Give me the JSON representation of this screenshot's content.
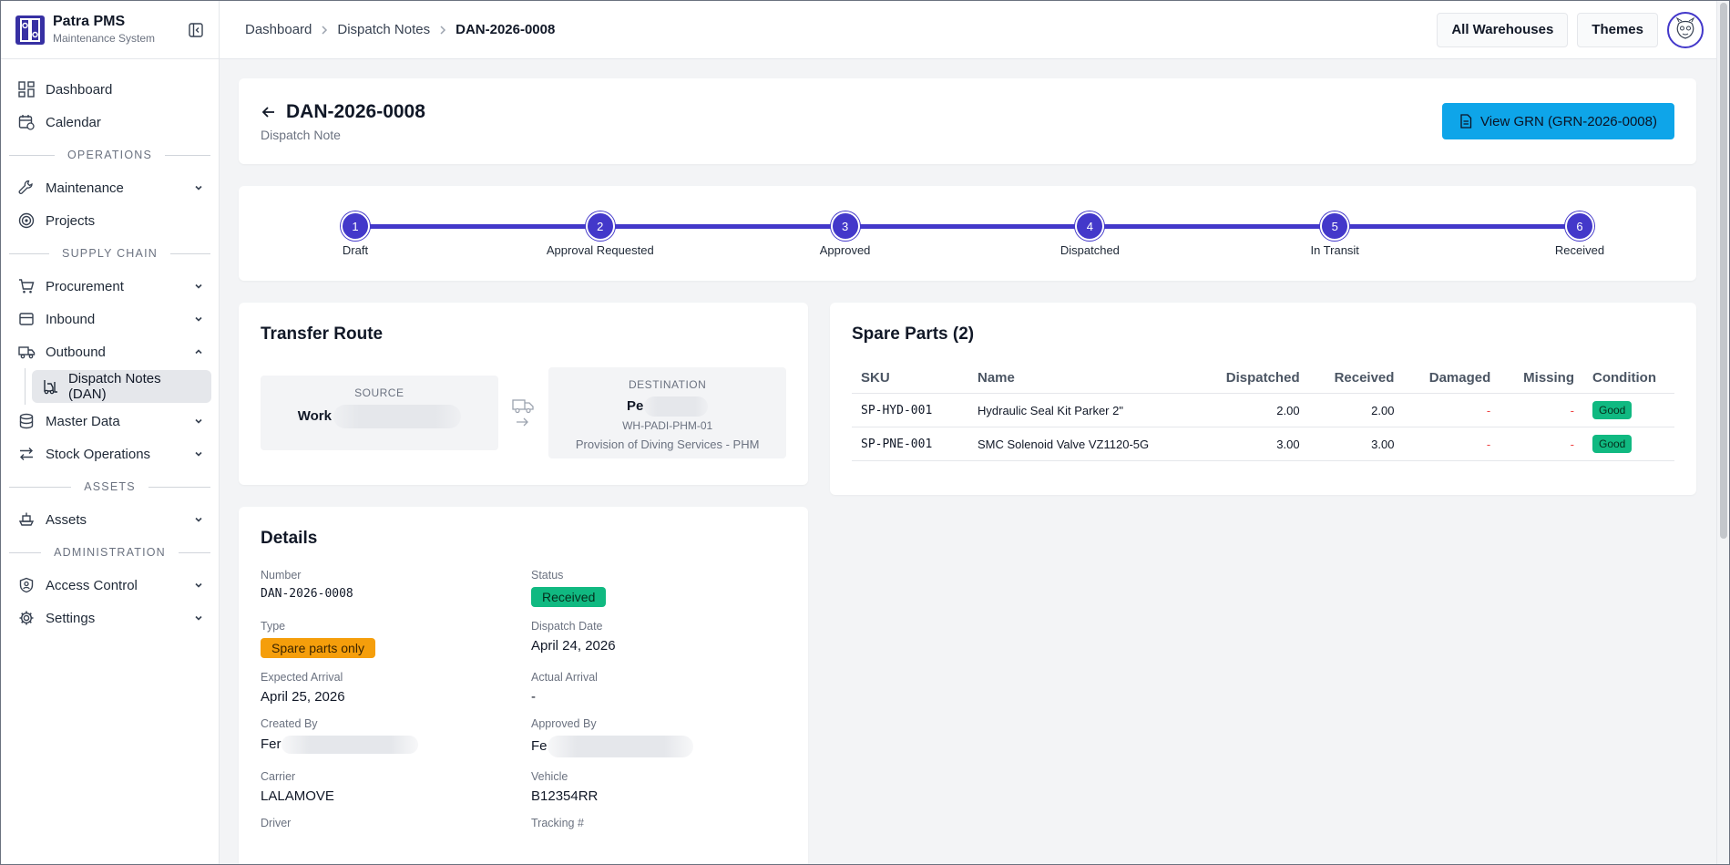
{
  "brand": {
    "title": "Patra PMS",
    "subtitle": "Maintenance System"
  },
  "nav": {
    "dashboard": "Dashboard",
    "calendar": "Calendar",
    "section_operations": "OPERATIONS",
    "maintenance": "Maintenance",
    "projects": "Projects",
    "section_supply": "SUPPLY CHAIN",
    "procurement": "Procurement",
    "inbound": "Inbound",
    "outbound": "Outbound",
    "dispatch_notes": "Dispatch Notes (DAN)",
    "master_data": "Master Data",
    "stock_operations": "Stock Operations",
    "section_assets": "ASSETS",
    "assets": "Assets",
    "section_admin": "ADMINISTRATION",
    "access_control": "Access Control",
    "settings": "Settings"
  },
  "breadcrumb": {
    "home": "Dashboard",
    "parent": "Dispatch Notes",
    "current": "DAN-2026-0008"
  },
  "topbar": {
    "warehouses": "All Warehouses",
    "themes": "Themes"
  },
  "header": {
    "title": "DAN-2026-0008",
    "subtitle": "Dispatch Note",
    "grn_button": "View GRN (GRN-2026-0008)"
  },
  "steps": [
    {
      "n": "1",
      "label": "Draft"
    },
    {
      "n": "2",
      "label": "Approval Requested"
    },
    {
      "n": "3",
      "label": "Approved"
    },
    {
      "n": "4",
      "label": "Dispatched"
    },
    {
      "n": "5",
      "label": "In Transit"
    },
    {
      "n": "6",
      "label": "Received"
    }
  ],
  "route": {
    "title": "Transfer Route",
    "source_label": "SOURCE",
    "source_name": "Work",
    "dest_label": "DESTINATION",
    "dest_name": "Pe",
    "dest_code": "WH-PADI-PHM-01",
    "dest_desc": "Provision of Diving Services - PHM"
  },
  "details": {
    "title": "Details",
    "number_label": "Number",
    "number": "DAN-2026-0008",
    "status_label": "Status",
    "status": "Received",
    "type_label": "Type",
    "type": "Spare parts only",
    "dispatch_date_label": "Dispatch Date",
    "dispatch_date": "April 24, 2026",
    "expected_label": "Expected Arrival",
    "expected": "April 25, 2026",
    "actual_label": "Actual Arrival",
    "actual": "-",
    "created_label": "Created By",
    "created": "Fer",
    "approved_label": "Approved By",
    "approved": "Fe",
    "carrier_label": "Carrier",
    "carrier": "LALAMOVE",
    "vehicle_label": "Vehicle",
    "vehicle": "B12354RR",
    "driver_label": "Driver",
    "tracking_label": "Tracking #"
  },
  "parts": {
    "title": "Spare Parts (2)",
    "columns": [
      "SKU",
      "Name",
      "Dispatched",
      "Received",
      "Damaged",
      "Missing",
      "Condition"
    ],
    "rows": [
      {
        "sku": "SP-HYD-001",
        "name": "Hydraulic Seal Kit Parker 2\"",
        "dispatched": "2.00",
        "received": "2.00",
        "damaged": "-",
        "missing": "-",
        "condition": "Good"
      },
      {
        "sku": "SP-PNE-001",
        "name": "SMC Solenoid Valve VZ1120-5G",
        "dispatched": "3.00",
        "received": "3.00",
        "damaged": "-",
        "missing": "-",
        "condition": "Good"
      }
    ]
  },
  "colors": {
    "accent": "#4338ca",
    "info_button": "#0ea5e9",
    "success": "#10b981",
    "warning": "#f59e0b"
  }
}
